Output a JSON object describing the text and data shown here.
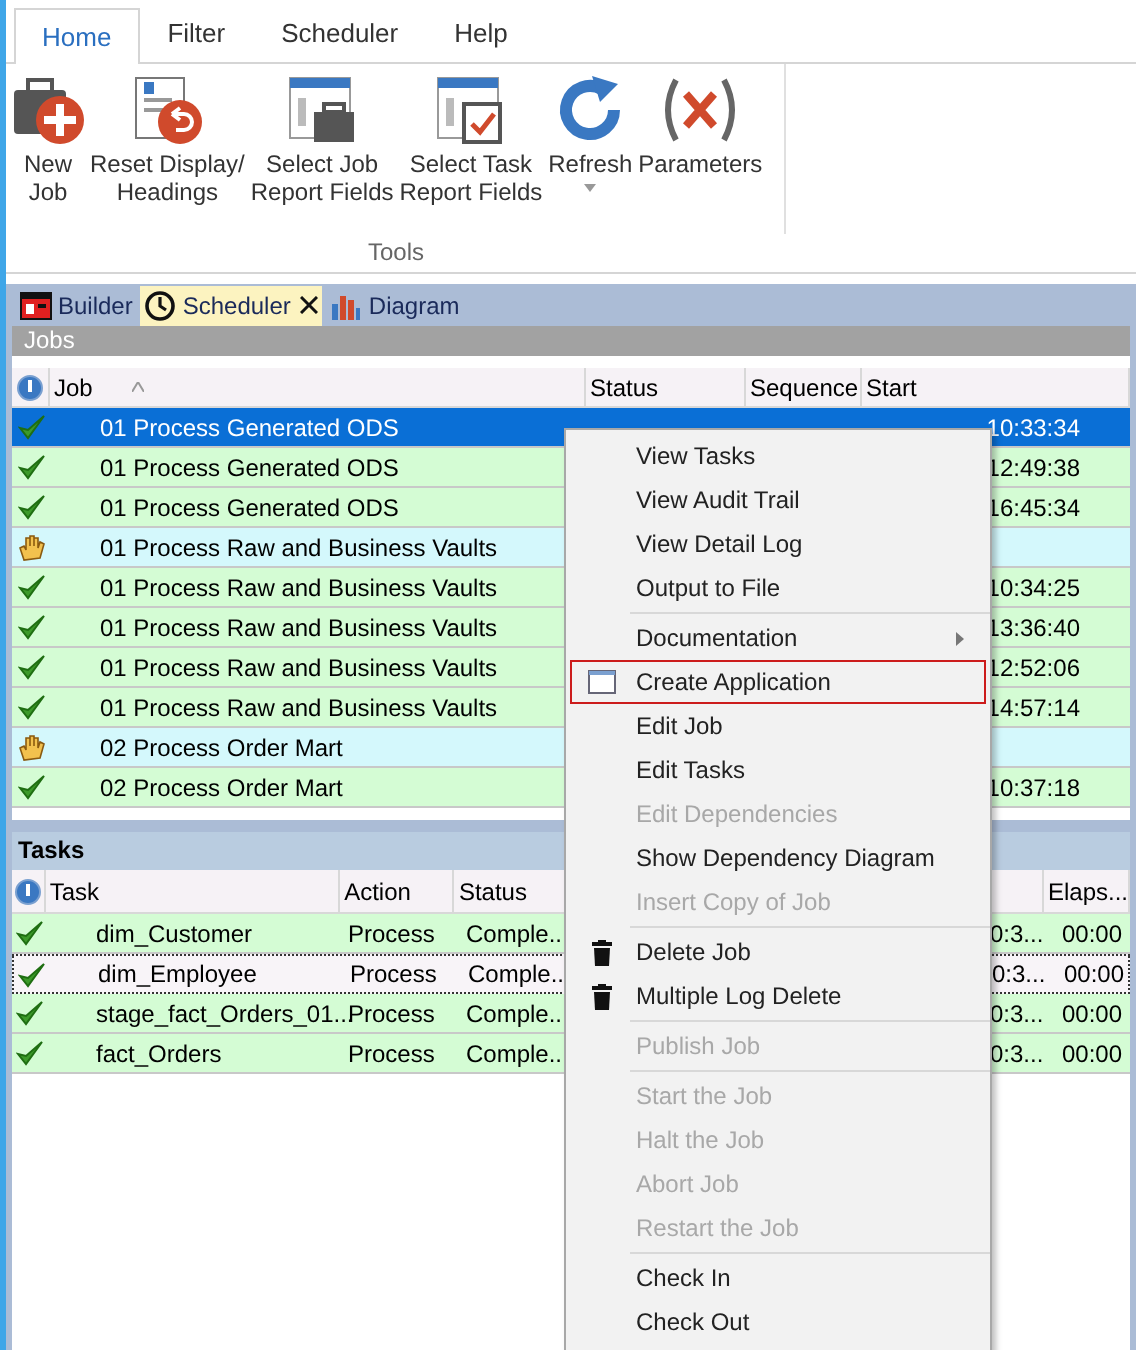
{
  "ribbon_tabs": [
    {
      "label": "Home",
      "selected": true
    },
    {
      "label": "Filter",
      "selected": false
    },
    {
      "label": "Scheduler",
      "selected": false
    },
    {
      "label": "Help",
      "selected": false
    }
  ],
  "ribbon": {
    "group": "Tools",
    "buttons": [
      {
        "kind": "new",
        "label": "New\nJob"
      },
      {
        "kind": "reset",
        "label": "Reset Display/\nHeadings"
      },
      {
        "kind": "jobfields",
        "label": "Select Job\nReport Fields"
      },
      {
        "kind": "taskfields",
        "label": "Select Task\nReport Fields"
      },
      {
        "kind": "refresh",
        "label": "Refresh",
        "dropdown": true
      },
      {
        "kind": "params",
        "label": "Parameters"
      }
    ]
  },
  "doc_tabs": [
    {
      "kind": "builder",
      "label": "Builder",
      "selected": false
    },
    {
      "kind": "scheduler",
      "label": "Scheduler",
      "selected": true,
      "closable": true
    },
    {
      "kind": "diagram",
      "label": "Diagram",
      "selected": false
    }
  ],
  "jobs": {
    "title": "Jobs",
    "columns": [
      "Job",
      "Status",
      "Sequence",
      "Start"
    ],
    "rows": [
      {
        "kind": "completed",
        "selected": true,
        "job": "01 Process Generated ODS",
        "start": "10:33:34"
      },
      {
        "kind": "completed",
        "selected": false,
        "job": "01 Process Generated ODS",
        "start": "12:49:38"
      },
      {
        "kind": "completed",
        "selected": false,
        "job": "01 Process Generated ODS",
        "start": "16:45:34"
      },
      {
        "kind": "hold",
        "selected": false,
        "job": "01 Process Raw and Business Vaults"
      },
      {
        "kind": "completed",
        "selected": false,
        "job": "01 Process Raw and Business Vaults",
        "start": "10:34:25"
      },
      {
        "kind": "completed",
        "selected": false,
        "job": "01 Process Raw and Business Vaults",
        "start": "13:36:40"
      },
      {
        "kind": "completed",
        "selected": false,
        "job": "01 Process Raw and Business Vaults",
        "start": "12:52:06"
      },
      {
        "kind": "completed",
        "selected": false,
        "job": "01 Process Raw and Business Vaults",
        "start": "14:57:14"
      },
      {
        "kind": "hold",
        "selected": false,
        "job": "02 Process Order Mart"
      },
      {
        "kind": "completed",
        "selected": false,
        "job": "02 Process Order Mart",
        "start": "10:37:18"
      }
    ]
  },
  "tasks": {
    "title": "Tasks",
    "columns": [
      "Task",
      "Action",
      "Status",
      "Elaps..."
    ],
    "rows": [
      {
        "kind": "completed",
        "selected": false,
        "task": "dim_Customer",
        "action": "Process",
        "status": "Comple..",
        "column_4": "0:3...",
        "elapsed": "00:00"
      },
      {
        "kind": "completed",
        "selected": true,
        "task": "dim_Employee",
        "action": "Process",
        "status": "Comple..",
        "column_4": "0:3...",
        "elapsed": "00:00"
      },
      {
        "kind": "completed",
        "selected": false,
        "task": "stage_fact_Orders_01...",
        "action": "Process",
        "status": "Comple..",
        "column_4": "0:3...",
        "elapsed": "00:00"
      },
      {
        "kind": "completed",
        "selected": false,
        "task": "fact_Orders",
        "action": "Process",
        "status": "Comple..",
        "column_4": "0:3...",
        "elapsed": "00:00"
      }
    ]
  },
  "context_menu": [
    {
      "kind": "plain",
      "label": "View Tasks",
      "disabled": false
    },
    {
      "kind": "plain",
      "label": "View Audit Trail",
      "disabled": false
    },
    {
      "kind": "plain",
      "label": "View Detail Log",
      "disabled": false
    },
    {
      "kind": "plain",
      "label": "Output to File",
      "disabled": false
    },
    {
      "kind": "separator"
    },
    {
      "kind": "plain",
      "label": "Documentation",
      "disabled": false,
      "submenu": true
    },
    {
      "kind": "window",
      "label": "Create Application",
      "disabled": false,
      "highlighted": true
    },
    {
      "kind": "plain",
      "label": "Edit Job",
      "disabled": false
    },
    {
      "kind": "plain",
      "label": "Edit Tasks",
      "disabled": false
    },
    {
      "kind": "plain",
      "label": "Edit Dependencies",
      "disabled": true
    },
    {
      "kind": "plain",
      "label": "Show Dependency Diagram",
      "disabled": false
    },
    {
      "kind": "plain",
      "label": "Insert Copy of Job",
      "disabled": true
    },
    {
      "kind": "separator"
    },
    {
      "kind": "trash",
      "label": "Delete Job",
      "disabled": false
    },
    {
      "kind": "trash",
      "label": "Multiple Log Delete",
      "disabled": false
    },
    {
      "kind": "separator"
    },
    {
      "kind": "plain",
      "label": "Publish Job",
      "disabled": true
    },
    {
      "kind": "separator"
    },
    {
      "kind": "plain",
      "label": "Start the Job",
      "disabled": true
    },
    {
      "kind": "plain",
      "label": "Halt the Job",
      "disabled": true
    },
    {
      "kind": "plain",
      "label": "Abort Job",
      "disabled": true
    },
    {
      "kind": "plain",
      "label": "Restart the Job",
      "disabled": true
    },
    {
      "kind": "separator"
    },
    {
      "kind": "plain",
      "label": "Check In",
      "disabled": false
    },
    {
      "kind": "plain",
      "label": "Check Out",
      "disabled": false
    }
  ]
}
